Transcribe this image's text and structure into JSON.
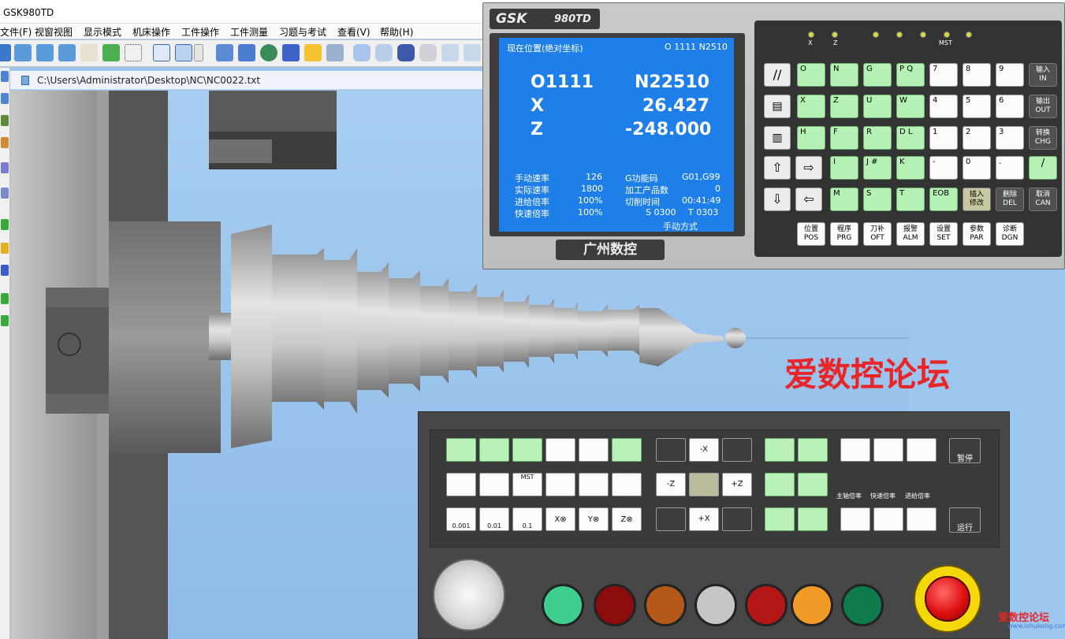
{
  "window": {
    "title": "GSK980TD"
  },
  "menu": [
    "文件(F)",
    "视窗视图",
    "显示模式",
    "机床操作",
    "工件操作",
    "工件测量",
    "习题与考试",
    "查看(V)",
    "帮助(H)"
  ],
  "file": {
    "path": "C:\\Users\\Administrator\\Desktop\\NC\\NC0022.txt"
  },
  "cnc": {
    "model": "980TD",
    "logo": "GSK",
    "brand": "广州数控",
    "screen": {
      "header_left": "现在位置(绝对坐标)",
      "header_right": "O 1111  N2510",
      "program": "O1111",
      "sequence": "N22510",
      "x_label": "X",
      "x_value": "26.427",
      "z_label": "Z",
      "z_value": "-248.000",
      "rows": [
        {
          "l1": "手动速率",
          "v1": "126",
          "l2": "G功能码",
          "v2": "G01,G99"
        },
        {
          "l1": "实际速率",
          "v1": "1800",
          "l2": "加工产品数",
          "v2": "0"
        },
        {
          "l1": "进给倍率",
          "v1": "100%",
          "l2": "切削时间",
          "v2": "00:41:49"
        },
        {
          "l1": "快速倍率",
          "v1": "100%",
          "l2": "S  0300",
          "v2": "T 0303"
        }
      ],
      "mode": "手动方式"
    },
    "leds": [
      "X",
      "Z",
      "",
      "",
      "MST",
      ""
    ],
    "addr_keys": [
      "O",
      "N",
      "G",
      "P Q",
      "X",
      "Z",
      "U",
      "W",
      "H",
      "F",
      "R",
      "D L",
      "I",
      "J #",
      "K",
      "M",
      "S",
      "T"
    ],
    "num_keys": [
      "7",
      "8",
      "9",
      "4",
      "5",
      "6",
      "1",
      "2",
      "3",
      "-",
      "0",
      ".",
      "EOB"
    ],
    "side_keys": [
      {
        "cn": "输入",
        "en": "IN"
      },
      {
        "cn": "输出",
        "en": "OUT"
      },
      {
        "cn": "转换",
        "en": "CHG"
      },
      {
        "cn": "/",
        "en": ""
      }
    ],
    "bottom_right_keys": [
      {
        "cn": "插入",
        "en": "修改"
      },
      {
        "cn": "删除",
        "en": "DEL"
      },
      {
        "cn": "取消",
        "en": "CAN"
      }
    ],
    "func_keys": [
      {
        "cn": "位置",
        "en": "POS"
      },
      {
        "cn": "程序",
        "en": "PRG"
      },
      {
        "cn": "刀补",
        "en": "OFT"
      },
      {
        "cn": "报警",
        "en": "ALM"
      },
      {
        "cn": "设置",
        "en": "SET"
      },
      {
        "cn": "参数",
        "en": "PAR"
      },
      {
        "cn": "诊断",
        "en": "DGN"
      }
    ]
  },
  "watermark": "爱数控论坛",
  "operator": {
    "jog_keys": [
      "-X",
      "-Z",
      "+Z",
      "+X"
    ],
    "step_labels": [
      "0.001",
      "0.01",
      "0.1",
      "X⊗",
      "Y⊗",
      "Z⊗"
    ],
    "mst_label": "MST",
    "pause_label": "暂停",
    "run_label": "运行",
    "override_labels": [
      "主轴倍率",
      "快速倍率",
      "进给倍率"
    ]
  },
  "corner_watermark": "爱数控论坛",
  "corner_url": "www.ishukong.com",
  "colors": {
    "screen": "#1f7fe8",
    "key_green": "#b5f0b5",
    "watermark": "#e8262a"
  }
}
